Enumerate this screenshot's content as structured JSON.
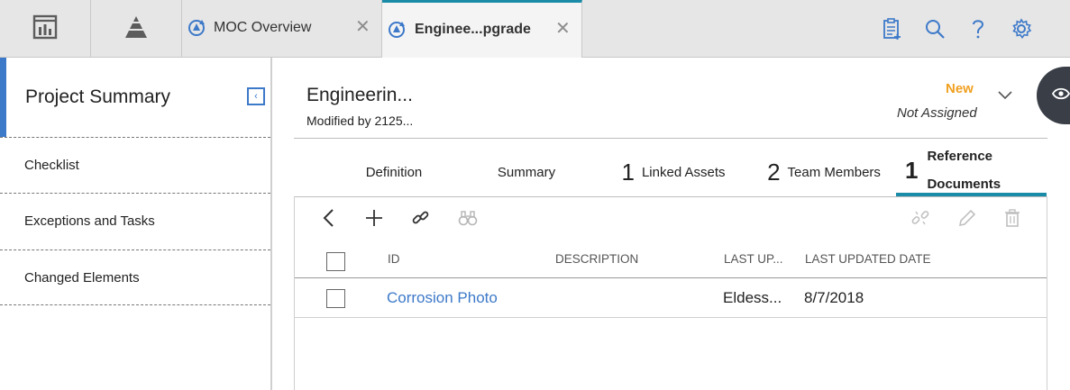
{
  "topbar": {
    "tabs": [
      {
        "label": "MOC Overview",
        "icon": "moc-refresh-icon"
      },
      {
        "label": "Enginee...pgrade",
        "icon": "moc-refresh-icon"
      }
    ],
    "close_glyph": "✕",
    "left_icons": [
      "dashboard-icon",
      "pyramid-icon"
    ],
    "right_icons": [
      "clipboard-list-icon",
      "search-icon",
      "help-icon",
      "settings-gear-icon"
    ],
    "accent_color": "#1a8ca8"
  },
  "left_panel": {
    "title": "Project Summary",
    "collapse_glyph": "‹",
    "items": [
      {
        "label": "Checklist"
      },
      {
        "label": "Exceptions and Tasks"
      },
      {
        "label": "Changed Elements"
      }
    ],
    "accent_color": "#3d79c9"
  },
  "record": {
    "title": "Engineerin...",
    "subtitle": "Modified by 2125...",
    "state": "New",
    "assignment": "Not Assigned",
    "state_color": "#f0a020"
  },
  "subtabs": [
    {
      "count": "",
      "label": "Definition"
    },
    {
      "count": "",
      "label": "Summary"
    },
    {
      "count": "1",
      "label": "Linked Assets"
    },
    {
      "count": "2",
      "label": "Team Members"
    },
    {
      "count": "1",
      "label_line1": "Reference",
      "label_line2": "Documents",
      "active": true
    }
  ],
  "grid": {
    "toolbar_left": [
      "back-chevron-icon",
      "add-plus-icon",
      "link-icon",
      "binoculars-icon"
    ],
    "toolbar_right": [
      "unlink-icon",
      "edit-pencil-icon",
      "delete-trash-icon"
    ],
    "columns": [
      "ID",
      "DESCRIPTION",
      "LAST UP...",
      "LAST UPDATED DATE"
    ],
    "rows": [
      {
        "id": "Corrosion Photo",
        "description": "",
        "last_updated_by": "Eldess...",
        "last_updated_date": "8/7/2018"
      }
    ]
  }
}
